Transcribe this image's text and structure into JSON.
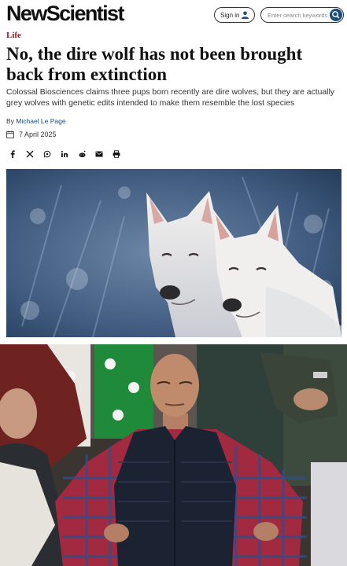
{
  "header": {
    "logo": "NewScientist",
    "sign_in_label": "Sign in",
    "search_placeholder": "Enter search keywords"
  },
  "article": {
    "section": "Life",
    "title": "No, the dire wolf has not been brought back from extinction",
    "subtitle": "Colossal Biosciences claims three pups born recently are dire wolves, but they are actually grey wolves with genetic edits intended to make them resemble the lost species",
    "byline_prefix": "By ",
    "author": "Michael Le Page",
    "date": "7 April 2025"
  },
  "share_icons": [
    "facebook-icon",
    "x-icon",
    "whatsapp-icon",
    "linkedin-icon",
    "reddit-icon",
    "email-icon",
    "print-icon"
  ],
  "colors": {
    "accent_red": "#b1121b",
    "link_blue": "#1b4d7a"
  }
}
